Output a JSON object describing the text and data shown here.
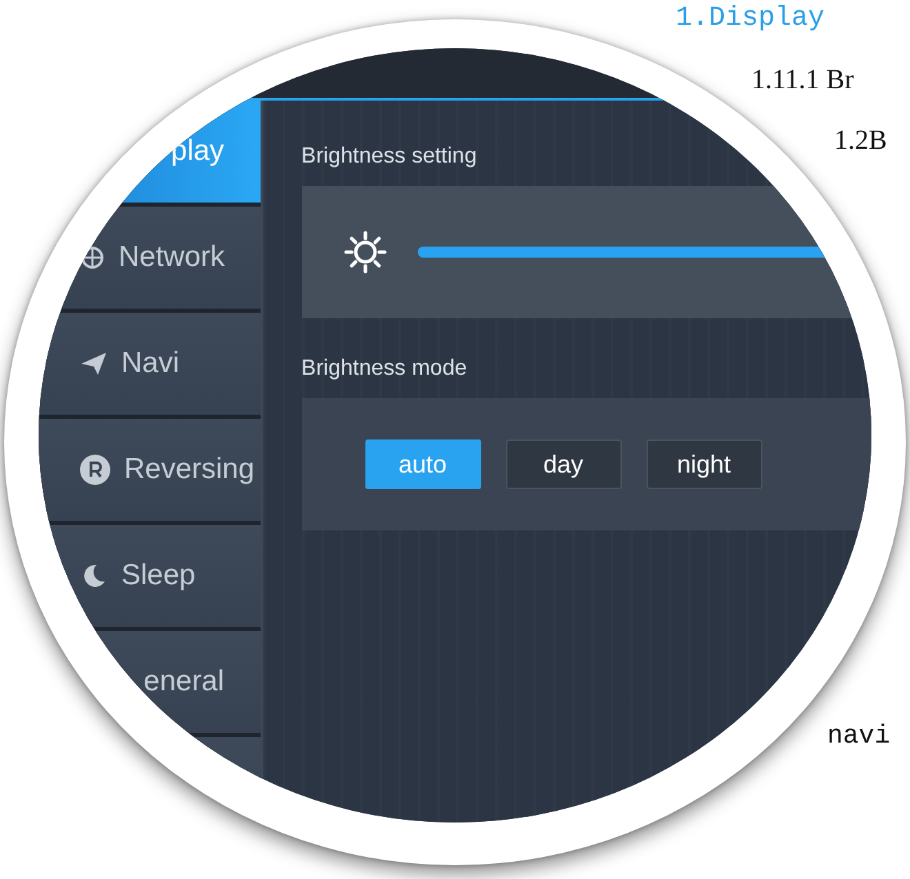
{
  "document": {
    "lines": [
      {
        "text": "1.Display",
        "kind": "heading"
      },
      {
        "text": "1.11.1 Br",
        "kind": "body"
      },
      {
        "text": "1.2B",
        "kind": "subbody"
      },
      {
        "text": "navi",
        "kind": "mono"
      }
    ]
  },
  "screen": {
    "sidebar": [
      {
        "label": "play",
        "selected": true
      },
      {
        "label": "Network",
        "selected": false
      },
      {
        "label": "Navi",
        "selected": false
      },
      {
        "label": "Reversing",
        "selected": false
      },
      {
        "label": "Sleep",
        "selected": false
      },
      {
        "label": "eneral",
        "selected": false
      },
      {
        "selected": false
      }
    ],
    "brightness": {
      "title": "Brightness setting"
    },
    "mode": {
      "title": "Brightness mode",
      "options": [
        {
          "label": "auto",
          "selected": true
        },
        {
          "label": "day",
          "selected": false
        },
        {
          "label": "night",
          "selected": false
        }
      ]
    }
  }
}
